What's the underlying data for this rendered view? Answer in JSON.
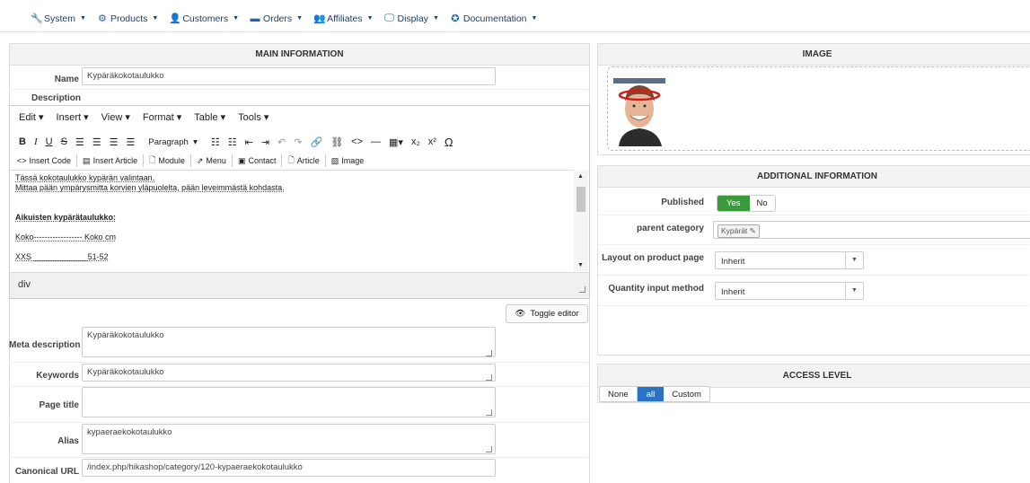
{
  "nav": {
    "items": [
      {
        "label": "System",
        "icon": "wrench-icon",
        "glyph": "🔧"
      },
      {
        "label": "Products",
        "icon": "cubes-icon",
        "glyph": "⚙"
      },
      {
        "label": "Customers",
        "icon": "user-icon",
        "glyph": "👤"
      },
      {
        "label": "Orders",
        "icon": "credit-card-icon",
        "glyph": "▬"
      },
      {
        "label": "Affiliates",
        "icon": "users-icon",
        "glyph": "👥"
      },
      {
        "label": "Display",
        "icon": "monitor-icon",
        "glyph": "🖵"
      },
      {
        "label": "Documentation",
        "icon": "life-ring-icon",
        "glyph": "✪"
      }
    ]
  },
  "main": {
    "title": "MAIN INFORMATION",
    "name_label": "Name",
    "name_value": "Kypäräkokotaulukko",
    "description_label": "Description",
    "toggle_editor": "Toggle editor",
    "meta_label": "Meta description",
    "meta_value": "Kypäräkokotaulukko",
    "keywords_label": "Keywords",
    "keywords_value": "Kypäräkokotaulukko",
    "pagetitle_label": "Page title",
    "pagetitle_value": "",
    "alias_label": "Alias",
    "alias_value": "kypaeraekokotaulukko",
    "canonical_label": "Canonical URL",
    "canonical_value": "/index.php/hikashop/category/120-kypaeraekokotaulukko"
  },
  "editor": {
    "menu": [
      "Edit",
      "Insert",
      "View",
      "Format",
      "Table",
      "Tools"
    ],
    "format_select": "Paragraph",
    "buttons": [
      "Insert Code",
      "Insert Article",
      "Module",
      "Menu",
      "Contact",
      "Article",
      "Image"
    ],
    "content": {
      "line1": "Tässä kokotaulukko kypärän valintaan.",
      "line2": "Mittaa pään ympärysmitta korvien yläpuolelta, pään leveimmästä kohdasta.",
      "heading": "Aikuisten kypärätaulukko:",
      "row1": "Koko------------------ Koko cm",
      "row2": "XXS ____________51-52"
    },
    "status_path": "div"
  },
  "image_panel": {
    "title": "IMAGE"
  },
  "additional": {
    "title": "ADDITIONAL INFORMATION",
    "published_label": "Published",
    "yes": "Yes",
    "no": "No",
    "parent_label": "parent category",
    "parent_tag": "Kypärät",
    "layout_label": "Layout on product page",
    "layout_value": "Inherit",
    "quantity_label": "Quantity input method",
    "quantity_value": "Inherit"
  },
  "access": {
    "title": "ACCESS LEVEL",
    "options": [
      "None",
      "all",
      "Custom"
    ]
  },
  "colors": {
    "primary": "#2a73c4",
    "yes_green": "#3a9b3a",
    "nav_text": "#1f3f68"
  }
}
